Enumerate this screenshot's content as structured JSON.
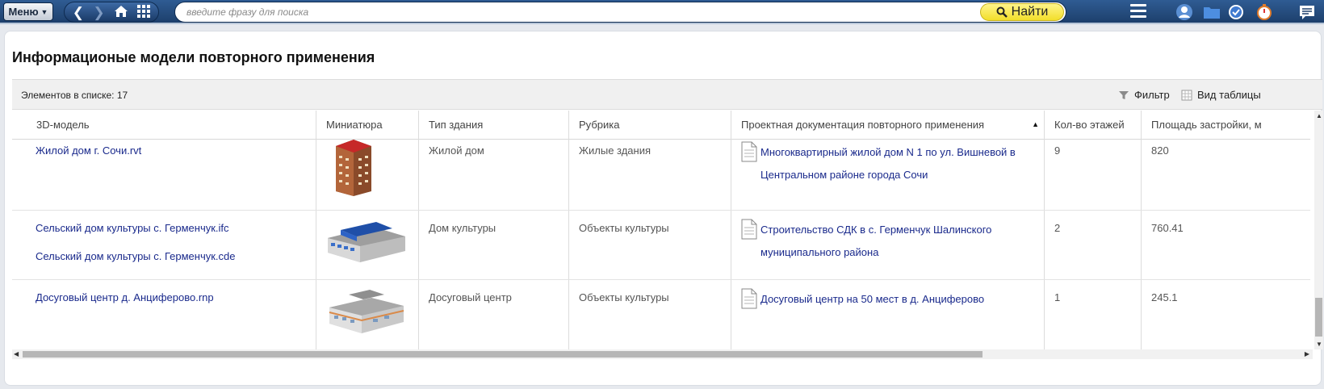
{
  "topbar": {
    "menu_label": "Меню",
    "search_placeholder": "введите фразу для поиска",
    "find_label": "Найти"
  },
  "page": {
    "title": "Информационые модели повторного применения"
  },
  "toolbar": {
    "count_label": "Элементов в списке: 17",
    "filter_label": "Фильтр",
    "view_label": "Вид таблицы"
  },
  "table": {
    "columns": [
      "3D-модель",
      "Миниатюра",
      "Тип здания",
      "Рубрика",
      "Проектная документация повторного применения",
      "Кол-во этажей",
      "Площадь застройки, м"
    ],
    "rows": [
      {
        "models": [
          "Жилой дом г. Сочи.rvt"
        ],
        "building_type": "Жилой дом",
        "rubric": "Жилые здания",
        "doc_lines": [
          "Многоквартирный жилой дом N 1 по ул. Вишневой в",
          "Центральном районе города Сочи"
        ],
        "floors": "9",
        "area": "820"
      },
      {
        "models": [
          "Сельский дом культуры с. Герменчук.ifc",
          "Сельский дом культуры с. Герменчук.cde"
        ],
        "building_type": "Дом культуры",
        "rubric": "Объекты культуры",
        "doc_lines": [
          "Строительство СДК в с. Герменчук Шалинского",
          "муниципального района"
        ],
        "floors": "2",
        "area": "760.41"
      },
      {
        "models": [
          "Досуговый центр д. Анциферово.rnp"
        ],
        "building_type": "Досуговый центр",
        "rubric": "Объекты культуры",
        "doc_lines": [
          "Досуговый центр на 50 мест в д. Анциферово"
        ],
        "floors": "1",
        "area": "245.1"
      }
    ]
  },
  "colors": {
    "topbar": "#1d3f6c",
    "find_button": "#f2de2a",
    "link": "#1a2a8c"
  }
}
